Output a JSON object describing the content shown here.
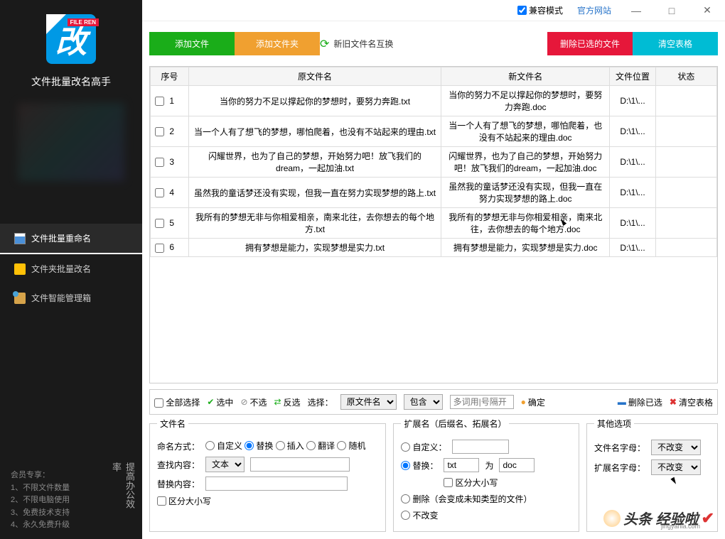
{
  "app": {
    "logo_banner": "FILE REN",
    "logo_char": "改",
    "title": "文件批量改名高手"
  },
  "sidebar_nav": [
    {
      "label": "文件批量重命名",
      "active": true,
      "icon": "doc"
    },
    {
      "label": "文件夹批量改名",
      "active": false,
      "icon": "folder"
    },
    {
      "label": "文件智能管理箱",
      "active": false,
      "icon": "box"
    }
  ],
  "member": {
    "title": "会员专享：",
    "lines": [
      "1、不限文件数量",
      "2、不限电脑使用",
      "3、免费技术支持",
      "4、永久免费升级"
    ],
    "vertical": "提高办公效率"
  },
  "titlebar": {
    "compat_mode": "兼容模式",
    "official_site": "官方网站"
  },
  "toolbar": {
    "add_file": "添加文件",
    "add_folder": "添加文件夹",
    "swap": "新旧文件名互换",
    "delete_selected": "删除已选的文件",
    "clear_table": "清空表格"
  },
  "table": {
    "headers": {
      "seq": "序号",
      "old": "原文件名",
      "new": "新文件名",
      "loc": "文件位置",
      "status": "状态"
    },
    "rows": [
      {
        "n": "1",
        "old": "当你的努力不足以撑起你的梦想时，要努力奔跑.txt",
        "new": "当你的努力不足以撑起你的梦想时，要努力奔跑.doc",
        "loc": "D:\\1\\..."
      },
      {
        "n": "2",
        "old": "当一个人有了想飞的梦想，哪怕爬着，也没有不站起来的理由.txt",
        "new": "当一个人有了想飞的梦想，哪怕爬着，也没有不站起来的理由.doc",
        "loc": "D:\\1\\..."
      },
      {
        "n": "3",
        "old": "闪耀世界，也为了自己的梦想，开始努力吧！放飞我们的dream，一起加油.txt",
        "new": "闪耀世界，也为了自己的梦想，开始努力吧！放飞我们的dream，一起加油.doc",
        "loc": "D:\\1\\..."
      },
      {
        "n": "4",
        "old": "虽然我的童话梦还没有实现，但我一直在努力实现梦想的路上.txt",
        "new": "虽然我的童话梦还没有实现，但我一直在努力实现梦想的路上.doc",
        "loc": "D:\\1\\..."
      },
      {
        "n": "5",
        "old": "我所有的梦想无非与你相爱相亲，南来北往，去你想去的每个地方.txt",
        "new": "我所有的梦想无非与你相爱相亲，南来北往，去你想去的每个地方.doc",
        "loc": "D:\\1\\..."
      },
      {
        "n": "6",
        "old": "拥有梦想是能力，实现梦想是实力.txt",
        "new": "拥有梦想是能力，实现梦想是实力.doc",
        "loc": "D:\\1\\..."
      }
    ]
  },
  "filter": {
    "select_all": "全部选择",
    "select": "选中",
    "unselect": "不选",
    "invert": "反选",
    "choose_label": "选择：",
    "field_opt": "原文件名",
    "cond_opt": "包含",
    "placeholder": "多词用|号隔开",
    "confirm": "确定",
    "delete_sel": "删除已选",
    "clear": "清空表格"
  },
  "panels": {
    "file": {
      "legend": "文件名",
      "naming_label": "命名方式：",
      "opts": [
        "自定义",
        "替换",
        "插入",
        "翻译",
        "随机"
      ],
      "find_label": "查找内容：",
      "find_type": "文本",
      "replace_label": "替换内容：",
      "case_sensitive": "区分大小写"
    },
    "ext": {
      "legend": "扩展名（后缀名、拓展名）",
      "custom": "自定义：",
      "replace": "替换：",
      "replace_from": "txt",
      "to_label": "为",
      "replace_to": "doc",
      "case_sensitive": "区分大小写",
      "delete_warn": "删除（会变成未知类型的文件）",
      "no_change": "不改变"
    },
    "other": {
      "legend": "其他选项",
      "file_letter": "文件名字母：",
      "ext_letter": "扩展名字母：",
      "no_change": "不改变"
    }
  },
  "watermark": {
    "main": "头条 经验啦",
    "sub": "jingyanla.com"
  }
}
